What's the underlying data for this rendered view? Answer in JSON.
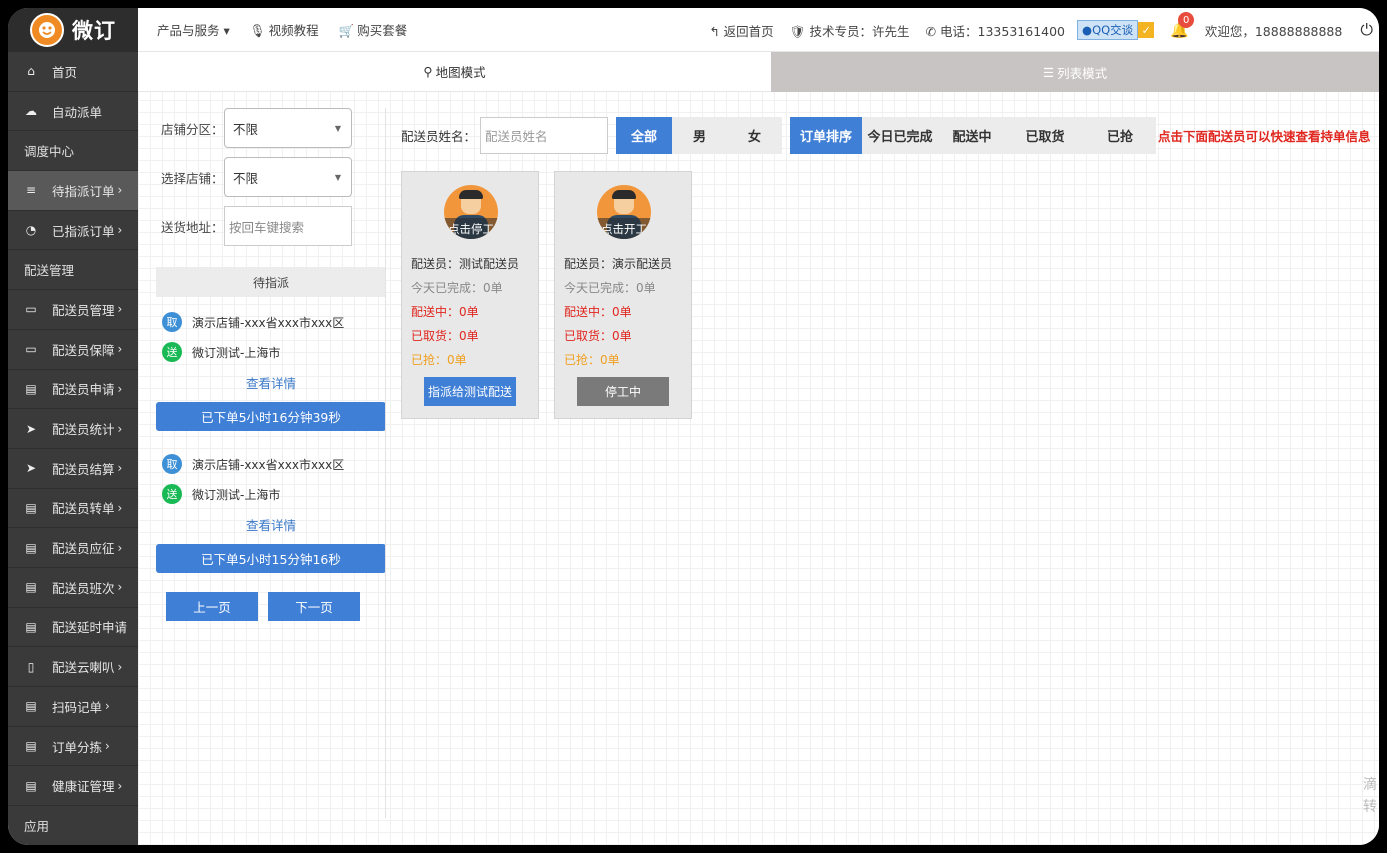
{
  "brand": {
    "name": "微订"
  },
  "sidebar": {
    "items": [
      {
        "label": "首页",
        "icon": "home-icon",
        "type": "item"
      },
      {
        "label": "自动派单",
        "icon": "cloud-icon",
        "type": "item"
      },
      {
        "label": "调度中心",
        "type": "section"
      },
      {
        "label": "待指派订单",
        "icon": "list-icon",
        "type": "item",
        "arrow": "›",
        "active": true
      },
      {
        "label": "已指派订单",
        "icon": "dashboard-icon",
        "type": "item",
        "arrow": "›"
      },
      {
        "label": "配送管理",
        "type": "section"
      },
      {
        "label": "配送员管理",
        "icon": "laptop-icon",
        "type": "item",
        "arrow": "›"
      },
      {
        "label": "配送员保障",
        "icon": "laptop-icon",
        "type": "item",
        "arrow": "›"
      },
      {
        "label": "配送员申请",
        "icon": "building-icon",
        "type": "item",
        "arrow": "›"
      },
      {
        "label": "配送员统计",
        "icon": "send-icon",
        "type": "item",
        "arrow": "›"
      },
      {
        "label": "配送员结算",
        "icon": "send-icon",
        "type": "item",
        "arrow": "›"
      },
      {
        "label": "配送员转单",
        "icon": "building-icon",
        "type": "item",
        "arrow": "›"
      },
      {
        "label": "配送员应征",
        "icon": "building-icon",
        "type": "item",
        "arrow": "›"
      },
      {
        "label": "配送员班次",
        "icon": "building-icon",
        "type": "item",
        "arrow": "›"
      },
      {
        "label": "配送延时申请",
        "icon": "building-icon",
        "type": "item"
      },
      {
        "label": "配送云喇叭",
        "icon": "file-icon",
        "type": "item",
        "arrow": "›"
      },
      {
        "label": "扫码记单",
        "icon": "building-icon",
        "type": "item",
        "arrow": "›"
      },
      {
        "label": "订单分拣",
        "icon": "building-icon",
        "type": "item",
        "arrow": "›"
      },
      {
        "label": "健康证管理",
        "icon": "building-icon",
        "type": "item",
        "arrow": "›"
      },
      {
        "label": "应用",
        "type": "section"
      }
    ]
  },
  "topbar": {
    "products": "产品与服务 ▾",
    "videos": "视频教程",
    "buy": "购买套餐",
    "back": "返回首页",
    "support": "技术专员：许先生",
    "phone": "电话：13353161400",
    "qq": "QQ交谈",
    "notifications": "0",
    "welcome": "欢迎您，18888888888"
  },
  "modes": {
    "map": "地图模式",
    "list": "列表模式"
  },
  "filters": {
    "area_label": "店铺分区：",
    "area_value": "不限",
    "shop_label": "选择店铺：",
    "shop_value": "不限",
    "address_label": "送货地址：",
    "address_placeholder": "按回车键搜索"
  },
  "pending": {
    "title": "待指派"
  },
  "orders": [
    {
      "pickup": "演示店铺-xxx省xxx市xxx区",
      "delivery": "微订测试-上海市",
      "detail": "查看详情",
      "elapsed": "已下单5小时16分钟39秒"
    },
    {
      "pickup": "演示店铺-xxx省xxx市xxx区",
      "delivery": "微订测试-上海市",
      "detail": "查看详情",
      "elapsed": "已下单5小时15分钟16秒"
    }
  ],
  "badges": {
    "pickup": "取",
    "delivery": "送"
  },
  "pager": {
    "prev": "上一页",
    "next": "下一页"
  },
  "courier_filter": {
    "name_label": "配送员姓名：",
    "name_placeholder": "配送员姓名",
    "gender": [
      "全部",
      "男",
      "女"
    ],
    "sort": [
      "订单排序",
      "今日已完成",
      "配送中",
      "已取货",
      "已抢"
    ],
    "hint": "点击下面配送员可以快速查看持单信息"
  },
  "couriers": [
    {
      "avatar_caption": "点击停工",
      "name": "配送员：测试配送员",
      "done": "今天已完成：0单",
      "delivering": "配送中：0单",
      "picked": "已取货：0单",
      "grabbed": "已抢：0单",
      "action": "指派给测试配送",
      "action_style": "blue"
    },
    {
      "avatar_caption": "点击开工",
      "name": "配送员：演示配送员",
      "done": "今天已完成：0单",
      "delivering": "配送中：0单",
      "picked": "已取货：0单",
      "grabbed": "已抢：0单",
      "action": "停工中",
      "action_style": "grey"
    }
  ],
  "watermark": "滴\n转"
}
